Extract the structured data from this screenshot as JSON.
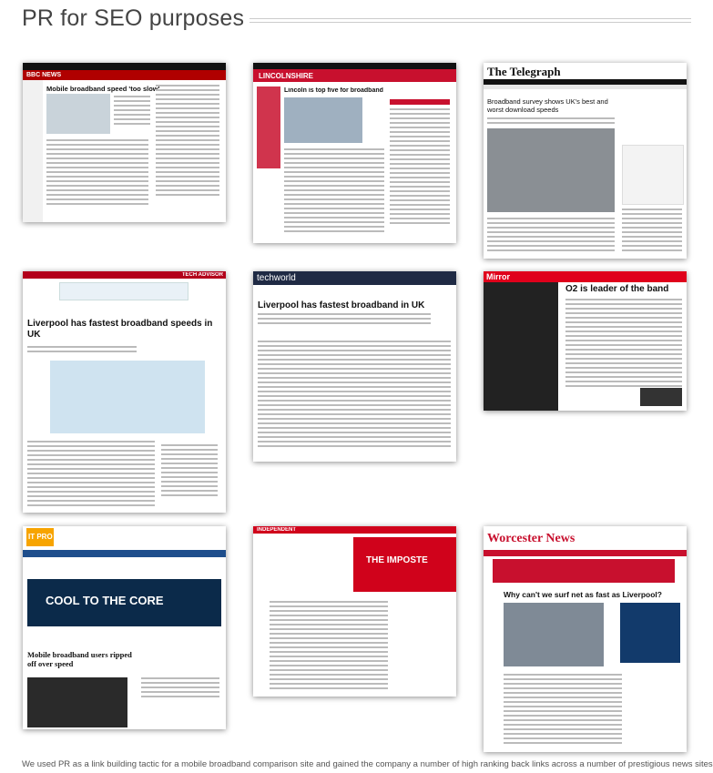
{
  "page": {
    "heading": "PR for SEO purposes",
    "caption": "We used PR as a link building tactic for a mobile broadband comparison site and gained the company a number of high ranking back links across a number of prestigious news sites – as well as"
  },
  "thumbnails": [
    {
      "site": "BBC NEWS",
      "headline": "Mobile broadband speed 'too slow'"
    },
    {
      "site": "LINCOLNSHIRE",
      "headline": "Lincoln is top five for broadband"
    },
    {
      "site": "The Telegraph",
      "headline": "Broadband survey shows UK's best and worst download speeds"
    },
    {
      "site": "TECH ADVISOR",
      "headline": "Liverpool has fastest broadband speeds in UK"
    },
    {
      "site": "techworld",
      "headline": "Liverpool has fastest broadband in UK"
    },
    {
      "site": "Mirror",
      "headline": "O2 is leader of the band"
    },
    {
      "site": "IT PRO",
      "headline": "Mobile broadband users ripped off over speed",
      "banner": "COOL TO THE CORE"
    },
    {
      "site": "INDEPENDENT",
      "headline": "THE IMPOSTE"
    },
    {
      "site": "Worcester News",
      "headline": "Why can't we surf net as fast as Liverpool?"
    }
  ],
  "colors": {
    "bbc_red": "#b00000",
    "lincs_red": "#c8102e",
    "telegraph_black": "#111111",
    "mirror_red": "#e0001b",
    "techworld_navy": "#1f2a44",
    "itpro_blue": "#1e4e8c",
    "indep_red": "#d0021b",
    "worcester_red": "#c8102e"
  }
}
